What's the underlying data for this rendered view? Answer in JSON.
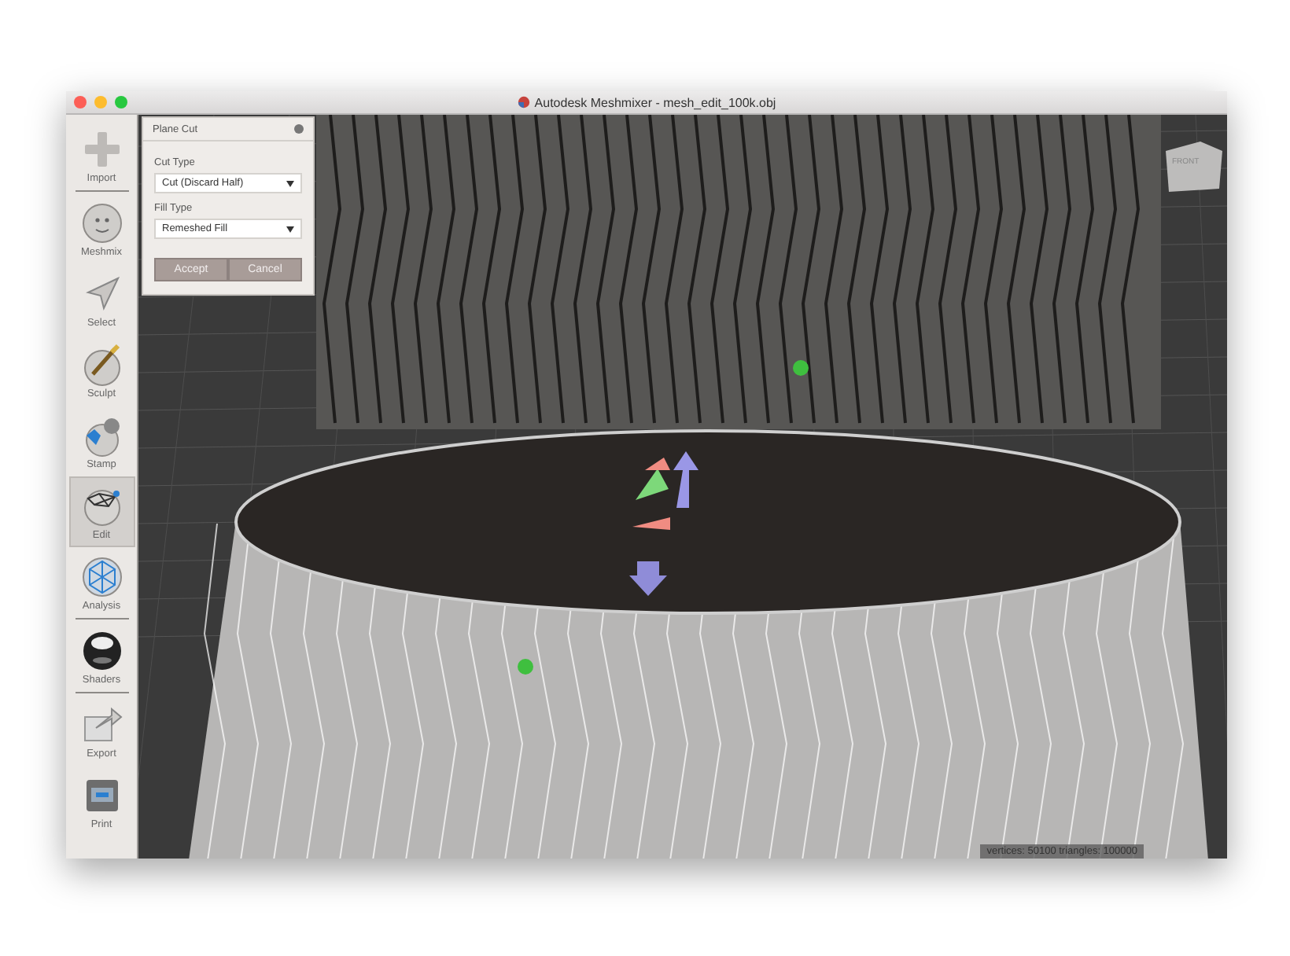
{
  "window": {
    "title": "Autodesk Meshmixer - mesh_edit_100k.obj"
  },
  "sidebar": {
    "items": [
      {
        "label": "Import",
        "selected": false
      },
      {
        "label": "Meshmix",
        "selected": false
      },
      {
        "label": "Select",
        "selected": false
      },
      {
        "label": "Sculpt",
        "selected": false
      },
      {
        "label": "Stamp",
        "selected": false
      },
      {
        "label": "Edit",
        "selected": true
      },
      {
        "label": "Analysis",
        "selected": false
      },
      {
        "label": "Shaders",
        "selected": false
      },
      {
        "label": "Export",
        "selected": false
      },
      {
        "label": "Print",
        "selected": false
      }
    ]
  },
  "panel": {
    "title": "Plane Cut",
    "fields": [
      {
        "label": "Cut Type",
        "value": "Cut (Discard Half)"
      },
      {
        "label": "Fill Type",
        "value": "Remeshed Fill"
      }
    ],
    "buttons": [
      "Accept",
      "Cancel"
    ]
  },
  "view_cube": {
    "label": "FRONT"
  },
  "status_bar": {
    "text": "vertices: 50100 triangles: 100000"
  }
}
